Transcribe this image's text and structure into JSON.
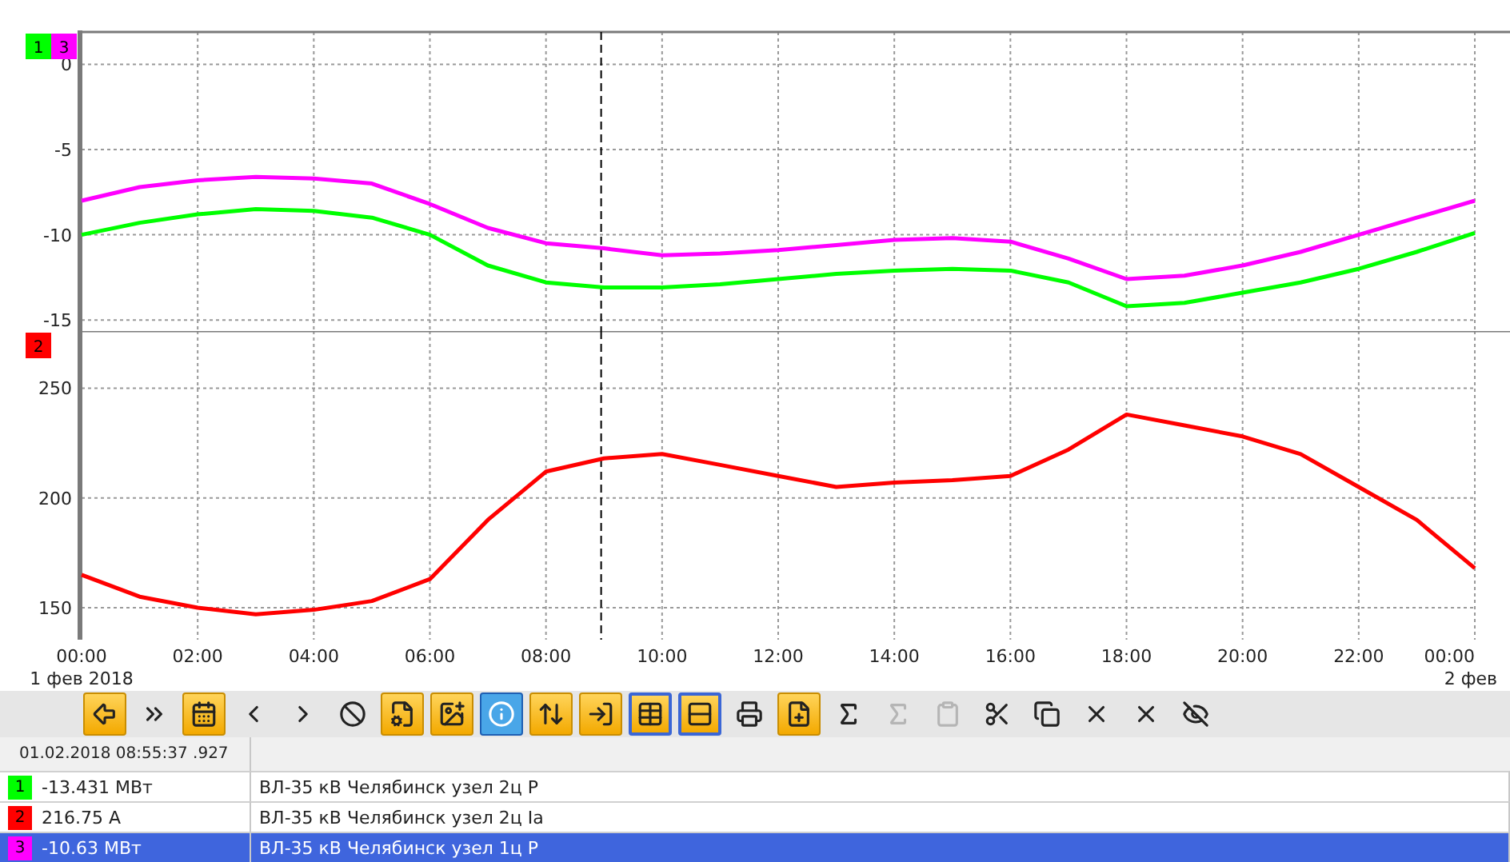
{
  "charts": [
    {
      "chart_data": {
        "type": "line",
        "grid": true,
        "ref_lines": [
          {
            "axis": "x",
            "value": 8.95
          }
        ],
        "x": [
          0,
          1,
          2,
          3,
          4,
          5,
          6,
          7,
          8,
          9,
          10,
          11,
          12,
          13,
          14,
          15,
          16,
          17,
          18,
          19,
          20,
          21,
          22,
          23,
          24
        ],
        "xlim": [
          0,
          24
        ],
        "ylim": [
          -15.65,
          1.9
        ],
        "yticks": [
          0,
          -5,
          -10,
          -15
        ],
        "series": [
          {
            "name": "1",
            "color": "#00ff00",
            "values": [
              -10,
              -9.3,
              -8.8,
              -8.5,
              -8.6,
              -9.0,
              -10.0,
              -11.8,
              -12.8,
              -13.1,
              -13.1,
              -12.9,
              -12.6,
              -12.3,
              -12.1,
              -12.0,
              -12.1,
              -12.8,
              -14.2,
              -14.0,
              -13.4,
              -12.8,
              -12.0,
              -11.0,
              -9.9
            ]
          },
          {
            "name": "3",
            "color": "#ff00ff",
            "values": [
              -8,
              -7.2,
              -6.8,
              -6.6,
              -6.7,
              -7.0,
              -8.2,
              -9.6,
              -10.5,
              -10.8,
              -11.2,
              -11.1,
              -10.9,
              -10.6,
              -10.3,
              -10.2,
              -10.4,
              -11.4,
              -12.6,
              -12.4,
              -11.8,
              -11.0,
              -10.0,
              -9.0,
              -8.0
            ]
          }
        ]
      }
    },
    {
      "chart_data": {
        "type": "line",
        "grid": true,
        "ref_lines": [
          {
            "axis": "x",
            "value": 8.95
          }
        ],
        "x": [
          0,
          1,
          2,
          3,
          4,
          5,
          6,
          7,
          8,
          9,
          10,
          11,
          12,
          13,
          14,
          15,
          16,
          17,
          18,
          19,
          20,
          21,
          22,
          23,
          24
        ],
        "xlim": [
          0,
          24
        ],
        "ylim": [
          135.4,
          276
        ],
        "yticks": [
          150,
          200,
          250
        ],
        "xticks": [
          {
            "value": 0,
            "label": "00:00"
          },
          {
            "value": 2,
            "label": "02:00"
          },
          {
            "value": 4,
            "label": "04:00"
          },
          {
            "value": 6,
            "label": "06:00"
          },
          {
            "value": 8,
            "label": "08:00"
          },
          {
            "value": 10,
            "label": "10:00"
          },
          {
            "value": 12,
            "label": "12:00"
          },
          {
            "value": 14,
            "label": "14:00"
          },
          {
            "value": 16,
            "label": "16:00"
          },
          {
            "value": 18,
            "label": "18:00"
          },
          {
            "value": 20,
            "label": "20:00"
          },
          {
            "value": 22,
            "label": "22:00"
          },
          {
            "value": 24,
            "label": "00:00"
          }
        ],
        "series": [
          {
            "name": "2",
            "color": "#ff0000",
            "values": [
              165,
              155,
              150,
              147,
              149,
              153,
              163,
              190,
              212,
              218,
              220,
              215,
              210,
              205,
              207,
              208,
              210,
              222,
              238,
              233,
              228,
              220,
              205,
              190,
              168
            ]
          }
        ]
      },
      "date_labels": [
        "1 фев 2018",
        "2 фев"
      ]
    }
  ],
  "toolbar": [
    {
      "kind": "orange",
      "active": false,
      "disabled": false
    },
    {
      "kind": "plain",
      "active": false,
      "disabled": false
    },
    {
      "kind": "orange",
      "active": false,
      "disabled": false
    },
    {
      "kind": "plain",
      "active": false,
      "disabled": false
    },
    {
      "kind": "plain",
      "active": false,
      "disabled": false
    },
    {
      "kind": "plain",
      "active": false,
      "disabled": false
    },
    {
      "kind": "orange",
      "active": false,
      "disabled": false
    },
    {
      "kind": "orange",
      "active": false,
      "disabled": false
    },
    {
      "kind": "blue",
      "active": false,
      "disabled": false
    },
    {
      "kind": "orange",
      "active": false,
      "disabled": false
    },
    {
      "kind": "orange",
      "active": false,
      "disabled": false
    },
    {
      "kind": "orange",
      "active": true,
      "disabled": false
    },
    {
      "kind": "orange",
      "active": true,
      "disabled": false
    },
    {
      "kind": "plain",
      "active": false,
      "disabled": false
    },
    {
      "kind": "orange",
      "active": false,
      "disabled": false
    },
    {
      "kind": "plain",
      "active": false,
      "disabled": false
    },
    {
      "kind": "plain",
      "active": false,
      "disabled": true
    },
    {
      "kind": "plain",
      "active": false,
      "disabled": true
    },
    {
      "kind": "plain",
      "active": false,
      "disabled": false
    },
    {
      "kind": "plain",
      "active": false,
      "disabled": false
    },
    {
      "kind": "plain",
      "active": false,
      "disabled": false
    },
    {
      "kind": "plain",
      "active": false,
      "disabled": false
    },
    {
      "kind": "plain",
      "active": false,
      "disabled": false
    }
  ],
  "table": {
    "header": "01.02.2018 08:55:37 .927",
    "rows": [
      {
        "number": "1",
        "color": "#00ff00",
        "value": "-13.431 МВт",
        "name": "ВЛ-35 кВ Челябинск узел 2ц P",
        "selected": false
      },
      {
        "number": "2",
        "color": "#ff0000",
        "value": "216.75 A",
        "name": "ВЛ-35 кВ Челябинск узел 2ц Ia",
        "selected": false
      },
      {
        "number": "3",
        "color": "#ff00ff",
        "value": "-10.63 МВт",
        "name": "ВЛ-35 кВ Челябинск узел 1ц P",
        "selected": true
      }
    ]
  }
}
